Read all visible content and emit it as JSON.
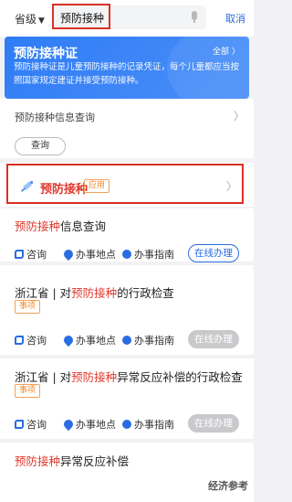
{
  "search": {
    "region": "省级",
    "query": "预防接种",
    "cancel": "取消"
  },
  "banner": {
    "title": "预防接种证",
    "all_link": "全部 〉",
    "description": "预防接种证是儿童预防接种的记录凭证，每个儿童都应当按照国家规定建证并接受预防接种。"
  },
  "query_section": {
    "label": "预防接种信息查询",
    "button": "查询"
  },
  "app_row": {
    "name": "预防接种",
    "tag": "应用"
  },
  "actions": {
    "consult": "咨询",
    "location": "办事地点",
    "guide": "办事指南",
    "online": "在线办理"
  },
  "results": [
    {
      "prefix": "",
      "highlight": "预防接种",
      "suffix": "信息查询",
      "tag": "",
      "online_enabled": true
    },
    {
      "prefix": "浙江省 | 对",
      "highlight": "预防接种",
      "suffix": "的行政检查",
      "tag": "事项",
      "online_enabled": false
    },
    {
      "prefix": "浙江省 | 对",
      "highlight": "预防接种",
      "suffix": "异常反应补偿的行政检查",
      "tag": "事项",
      "online_enabled": false
    },
    {
      "prefix": "",
      "highlight": "预防接种",
      "suffix": "异常反应补偿",
      "tag": "",
      "online_enabled": false
    }
  ],
  "watermark": "经济参考",
  "colors": {
    "accent": "#2a6de1",
    "highlight": "#e03a2e",
    "tag": "#f08a2a",
    "banner": "#2f7cf6"
  }
}
